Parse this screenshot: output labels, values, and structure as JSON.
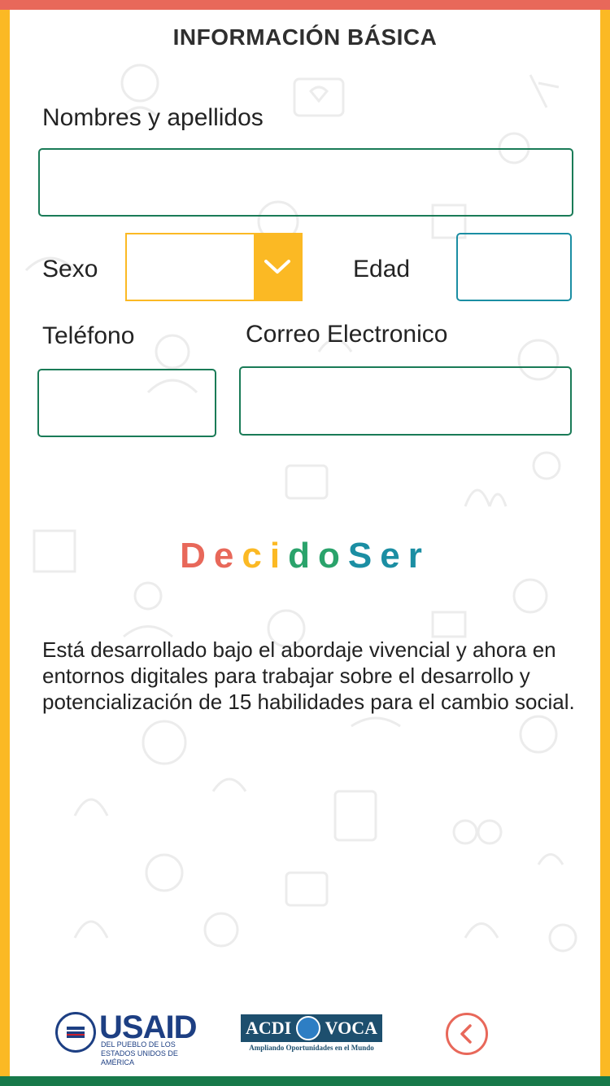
{
  "header": {
    "title": "INFORMACIÓN BÁSICA"
  },
  "form": {
    "name_label": "Nombres y apellidos",
    "sex_label": "Sexo",
    "age_label": "Edad",
    "phone_label": "Teléfono",
    "email_label": "Correo Electronico",
    "name_value": "",
    "sex_value": "",
    "age_value": "",
    "phone_value": "",
    "email_value": ""
  },
  "brand": {
    "logo_letters": [
      "D",
      "e",
      "c",
      "i",
      "d",
      "o",
      "S",
      "e",
      "r"
    ],
    "logo_colors": [
      "#e8685a",
      "#e8685a",
      "#fbb924",
      "#fbb924",
      "#2aa36b",
      "#2aa36b",
      "#1b8ea3",
      "#1b8ea3",
      "#1b8ea3"
    ]
  },
  "description": "Está desarrollado bajo el abordaje vivencial y ahora en entornos digitales para trabajar sobre el desarrollo y potencialización de 15 habilidades para el cambio social.",
  "footer": {
    "usaid_name": "USAID",
    "usaid_tagline": "DEL PUEBLO DE LOS ESTADOS UNIDOS DE AMÉRICA",
    "acdi_left": "ACDI",
    "acdi_right": "VOCA",
    "acdi_tagline": "Ampliando Oportunidades en el Mundo",
    "back_icon": "chevron-left-icon"
  },
  "colors": {
    "top_bar": "#e8685a",
    "bottom_bar": "#17794a",
    "side_bars": "#fbb924",
    "field_border": "#1a7b57",
    "age_border": "#1b8ea3",
    "select_accent": "#fbb924"
  }
}
